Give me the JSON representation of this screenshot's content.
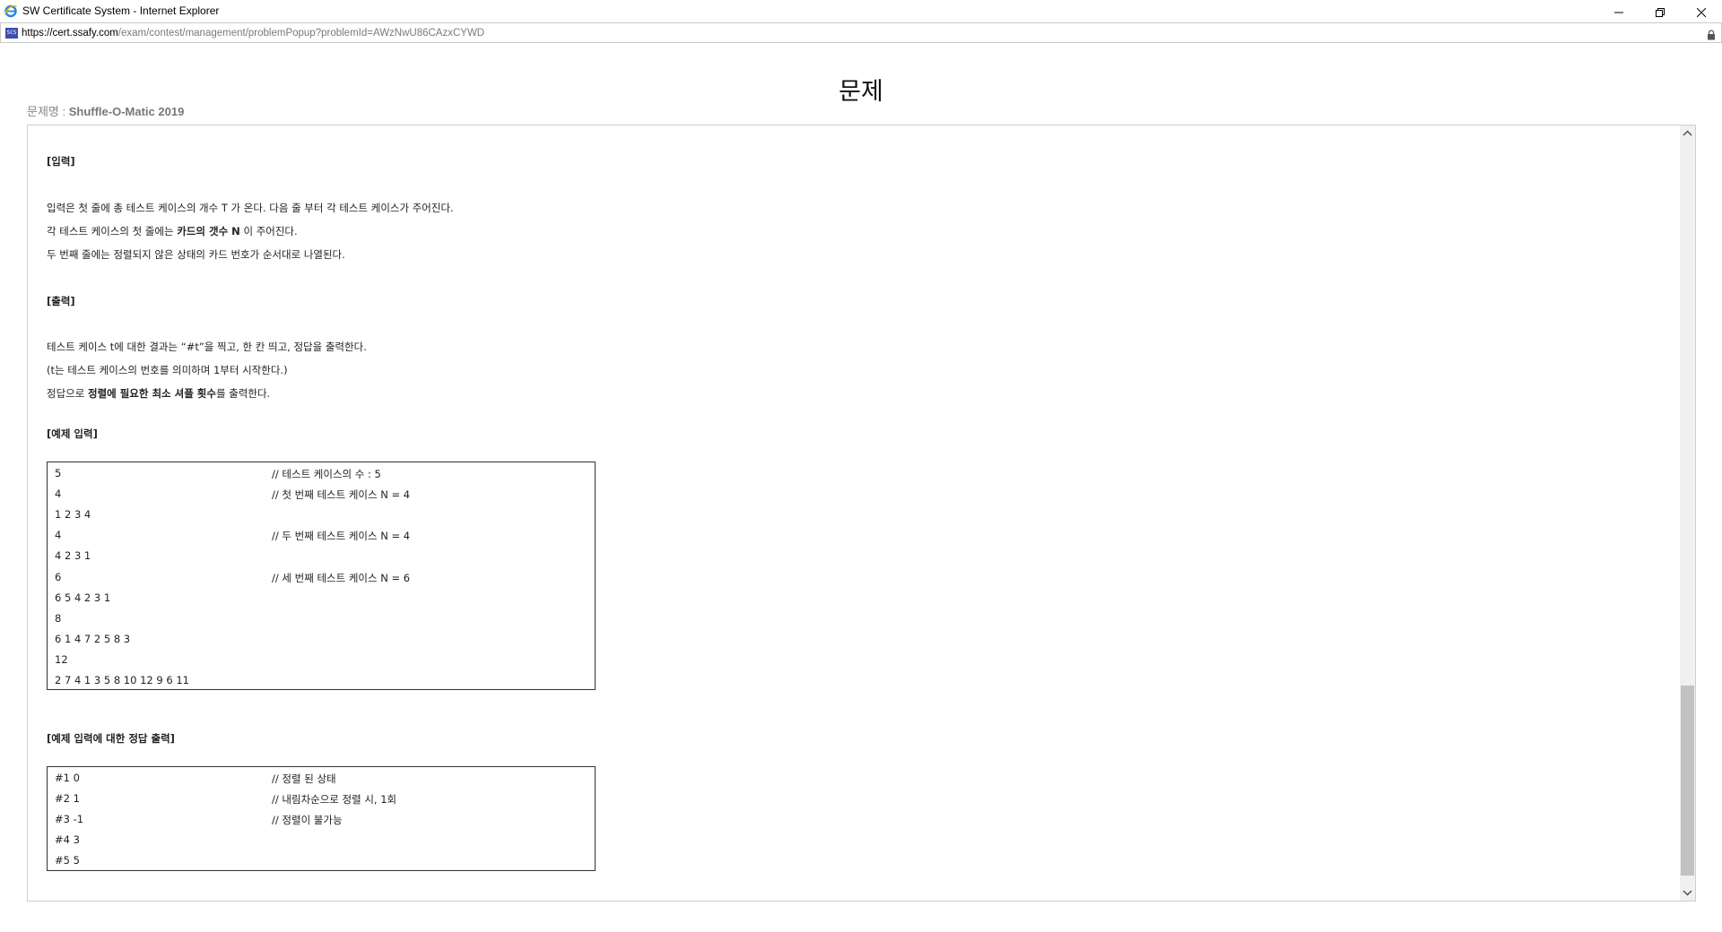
{
  "window": {
    "title": "SW Certificate System - Internet Explorer"
  },
  "address": {
    "site_icon_text": "SCS",
    "url_host": "https://cert.ssafy.com",
    "url_path": "/exam/contest/management/problemPopup?problemId=AWzNwU86CAzxCYWD"
  },
  "page": {
    "title": "문제",
    "problem_label": "문제명 : ",
    "problem_name": "Shuffle-O-Matic 2019"
  },
  "input_section": {
    "heading": "[입력]",
    "line1": "입력은 첫 줄에 총 테스트 케이스의 개수 T 가 온다. 다음 줄 부터 각 테스트 케이스가 주어진다.",
    "line2_pre": "각 테스트 케이스의 첫 줄에는 ",
    "line2_bold": "카드의 갯수 N",
    "line2_post": " 이 주어진다.",
    "line3": "두 번째 줄에는 정렬되지 않은 상태의 카드 번호가 순서대로 나열된다."
  },
  "output_section": {
    "heading": "[출력]",
    "line1": "테스트 케이스 t에 대한 결과는 “#t”을 찍고, 한 칸 띄고, 정답을 출력한다.",
    "line2": "(t는 테스트 케이스의 번호를 의미하며 1부터 시작한다.)",
    "line3_pre": "정답으로 ",
    "line3_bold": "정렬에 필요한 최소 셔플 횟수",
    "line3_post": "를 출력한다."
  },
  "sample_input": {
    "heading": "[예제 입력]",
    "rows": [
      {
        "left": "5",
        "comment": "// 테스트  케이스의  수 : 5"
      },
      {
        "left": "4",
        "comment": "// 첫  번째  테스트  케이스  N = 4"
      },
      {
        "left": "1 2 3 4",
        "comment": ""
      },
      {
        "left": "4",
        "comment": "// 두  번째  테스트  케이스  N = 4"
      },
      {
        "left": "4 2 3 1",
        "comment": ""
      },
      {
        "left": "6",
        "comment": "// 세  번째  테스트  케이스  N = 6"
      },
      {
        "left": "6 5 4 2 3 1",
        "comment": ""
      },
      {
        "left": "8",
        "comment": ""
      },
      {
        "left": "6 1 4 7 2 5 8 3",
        "comment": ""
      },
      {
        "left": "12",
        "comment": ""
      },
      {
        "left": "2 7 4 1 3 5 8 10 12 9 6 11",
        "comment": ""
      }
    ]
  },
  "sample_output": {
    "heading": "[예제 입력에 대한 정답 출력]",
    "rows": [
      {
        "left": "#1 0",
        "comment": "// 정렬  된  상태"
      },
      {
        "left": "#2 1",
        "comment": "// 내림차순으로  정렬  시, 1회"
      },
      {
        "left": "#3 -1",
        "comment": "// 정렬이  불가능"
      },
      {
        "left": "#4 3",
        "comment": ""
      },
      {
        "left": "#5 5",
        "comment": ""
      }
    ]
  },
  "scrollbar": {
    "position_fraction": 0.7
  },
  "icons": {
    "browser": "internet-explorer-icon",
    "minimize": "minimize-icon",
    "restore": "restore-icon",
    "close": "close-icon",
    "lock": "lock-icon",
    "scroll_up": "chevron-up-icon",
    "scroll_down": "chevron-down-icon"
  },
  "colors": {
    "ie_blue": "#1e88e5",
    "site_icon": "#3c4ea8",
    "scroll_thumb": "#c2c2c2"
  }
}
